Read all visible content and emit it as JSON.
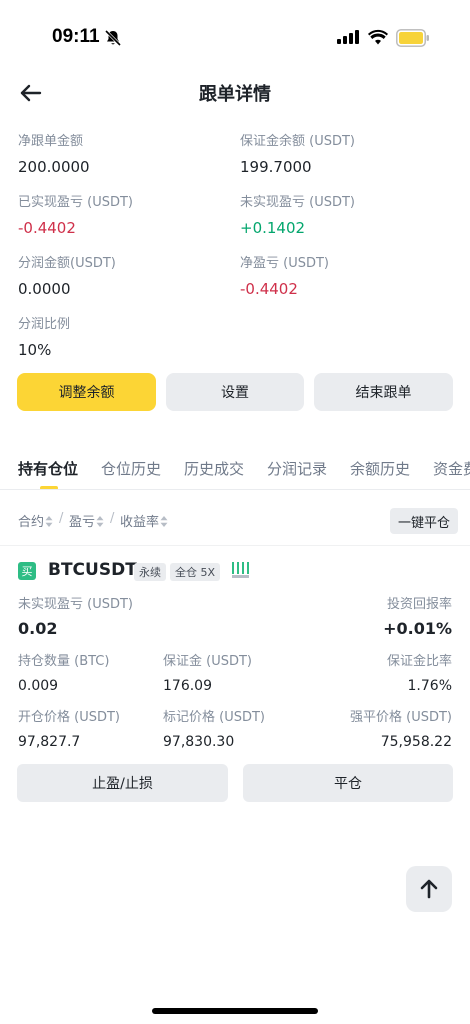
{
  "status_bar": {
    "time": "09:11"
  },
  "header": {
    "title": "跟单详情"
  },
  "summary": [
    {
      "label": "净跟单金额",
      "value": "200.0000",
      "tone": ""
    },
    {
      "label": "保证金余额 (USDT)",
      "value": "199.7000",
      "tone": ""
    },
    {
      "label": "已实现盈亏 (USDT)",
      "value": "-0.4402",
      "tone": "neg"
    },
    {
      "label": "未实现盈亏 (USDT)",
      "value": "+0.1402",
      "tone": "pos"
    },
    {
      "label": "分润金额(USDT)",
      "value": "0.0000",
      "tone": ""
    },
    {
      "label": "净盈亏 (USDT)",
      "value": "-0.4402",
      "tone": "neg"
    },
    {
      "label": "分润比例",
      "value": "10%",
      "tone": ""
    }
  ],
  "actions": {
    "adjust": "调整余额",
    "settings": "设置",
    "end": "结束跟单"
  },
  "tabs": [
    "持有仓位",
    "仓位历史",
    "历史成交",
    "分润记录",
    "余额历史",
    "资金费"
  ],
  "filters": {
    "contract": "合约",
    "pnl": "盈亏",
    "roi": "收益率",
    "close_all": "一键平仓"
  },
  "position": {
    "side_badge": "买",
    "symbol": "BTCUSDT",
    "type_tag": "永续",
    "margin_tag": "全仓 5X",
    "unrealized_label": "未实现盈亏 (USDT)",
    "unrealized_value": "0.02",
    "roi_label": "投资回报率",
    "roi_value": "+0.01%",
    "size_label": "持仓数量 (BTC)",
    "size_value": "0.009",
    "margin_label": "保证金 (USDT)",
    "margin_value": "176.09",
    "margin_ratio_label": "保证金比率",
    "margin_ratio_value": "1.76%",
    "entry_label": "开仓价格 (USDT)",
    "entry_value": "97,827.7",
    "mark_label": "标记价格 (USDT)",
    "mark_value": "97,830.30",
    "liq_label": "强平价格 (USDT)",
    "liq_value": "75,958.22",
    "tpsl_label": "止盈/止损",
    "close_label": "平仓"
  },
  "colors": {
    "accent": "#fcd535",
    "positive": "#03a66d",
    "negative": "#cf304a"
  },
  "icons": [
    "back-arrow-icon",
    "bell-off-icon",
    "signal-icon",
    "wifi-icon",
    "battery-icon",
    "sort-icon",
    "bars-icon",
    "arrow-up-icon"
  ]
}
